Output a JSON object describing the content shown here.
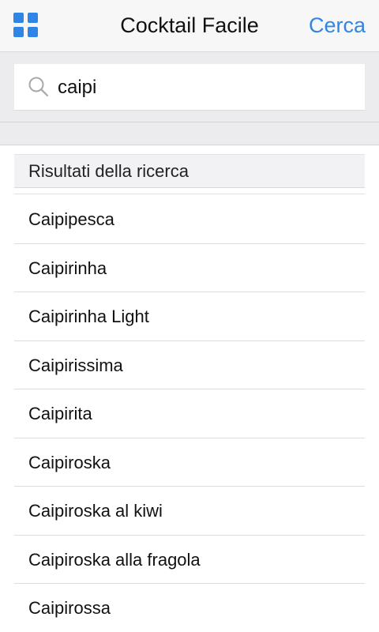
{
  "navbar": {
    "title": "Cocktail Facile",
    "action_label": "Cerca",
    "menu_icon": "grid-icon",
    "accent_color": "#2f86e6"
  },
  "search": {
    "value": "caipi",
    "icon": "search-icon"
  },
  "results": {
    "header": "Risultati della ricerca",
    "items": [
      "Caipipesca",
      "Caipirinha",
      "Caipirinha Light",
      "Caipirissima",
      "Caipirita",
      "Caipiroska",
      "Caipiroska al kiwi",
      "Caipiroska alla fragola",
      "Caipirossa"
    ]
  }
}
